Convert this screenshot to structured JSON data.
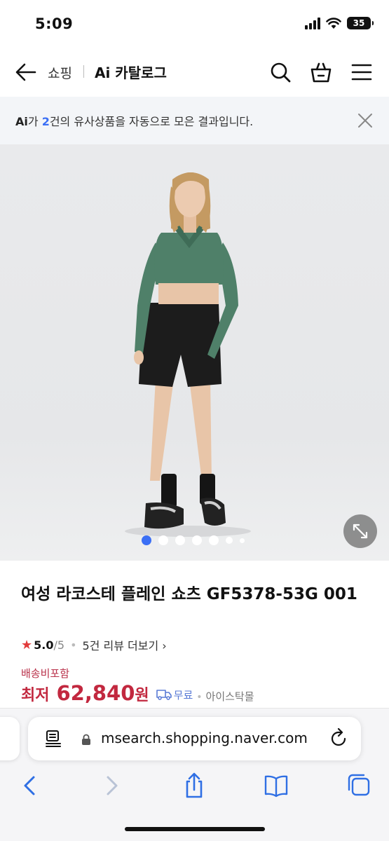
{
  "status_bar": {
    "time": "5:09",
    "battery": "35"
  },
  "header": {
    "breadcrumb_shop": "쇼핑",
    "title": "Ai 카탈로그"
  },
  "ai_banner": {
    "logo": "Ai",
    "prefix": "가 ",
    "count": "2",
    "suffix": "건의 유사상품을 자동으로 모은 결과입니다."
  },
  "product": {
    "title": "여성 라코스테 플레인 쇼츠 GF5378-53G 001",
    "rating": "5.0",
    "rating_max": "/5",
    "review_link": "5건 리뷰 더보기",
    "shipping_label": "배송비포함",
    "price_prefix": "최저",
    "price": "62,840",
    "price_unit": "원",
    "shipping_free": "무료",
    "seller": "아이스탁몰",
    "image_dots": 7,
    "active_dot": 1,
    "image_description": "model-wearing-green-crop-top-and-black-shorts"
  },
  "browser": {
    "url": "msearch.shopping.naver.com"
  },
  "colors": {
    "accent_blue": "#3b6ff5",
    "price_red": "#c2283f",
    "banner_bg": "#f3f5f8"
  }
}
